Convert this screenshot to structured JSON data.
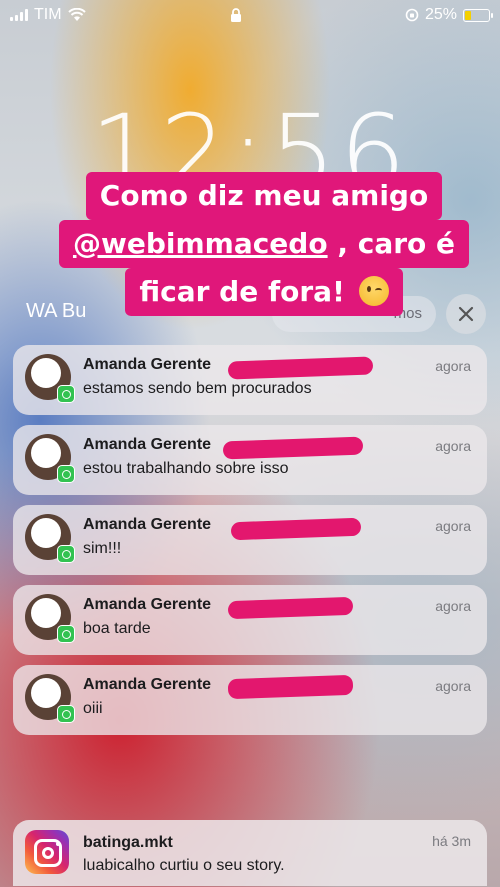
{
  "status_bar": {
    "carrier": "TIM",
    "battery_percent": "25%",
    "battery_level": 0.25,
    "battery_color": "#f4d000"
  },
  "lock_screen": {
    "time": "12:56",
    "group_title": "WA Bu",
    "show_less_label": "mos"
  },
  "story_caption": {
    "line1": "Como diz meu amigo",
    "mention": "@webimmacedo",
    "line2_rest": " , caro é",
    "line3": "ficar de fora!",
    "emoji": "winking-face",
    "highlight_color": "#e0177a"
  },
  "notifications": [
    {
      "sender": "Amanda Gerente",
      "message": "estamos sendo bem procurados",
      "time": "agora",
      "app_icon": "whatsapp-icon"
    },
    {
      "sender": "Amanda Gerente",
      "message": "estou trabalhando sobre isso",
      "time": "agora",
      "app_icon": "whatsapp-icon"
    },
    {
      "sender": "Amanda Gerente",
      "message": "sim!!!",
      "time": "agora",
      "app_icon": "whatsapp-icon"
    },
    {
      "sender": "Amanda Gerente",
      "message": "boa tarde",
      "time": "agora",
      "app_icon": "whatsapp-icon"
    },
    {
      "sender": "Amanda Gerente",
      "message": "oiii",
      "time": "agora",
      "app_icon": "whatsapp-icon"
    }
  ],
  "instagram_notification": {
    "account": "batinga.mkt",
    "message": "luabicalho curtiu o seu story.",
    "time": "há 3m",
    "app_icon": "instagram-icon"
  },
  "colors": {
    "redaction": "#e3176e",
    "whatsapp": "#32c251"
  }
}
